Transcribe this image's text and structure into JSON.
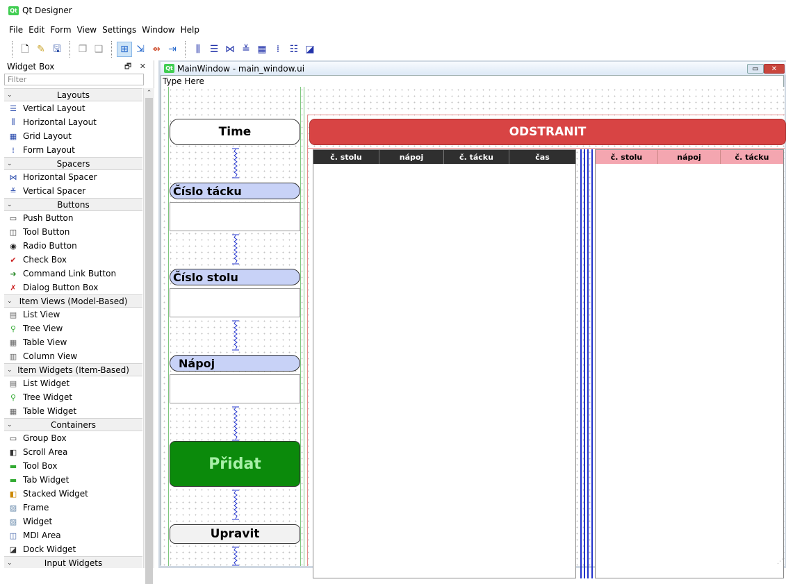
{
  "app": {
    "title": "Qt Designer",
    "logo_text": "Qt"
  },
  "menu": [
    "File",
    "Edit",
    "Form",
    "View",
    "Settings",
    "Window",
    "Help"
  ],
  "toolbar": {
    "groups": [
      [
        "new-file-icon",
        "open-file-icon",
        "save-file-icon"
      ],
      [
        "send-to-back-icon",
        "bring-to-front-icon"
      ],
      [
        "edit-widgets-icon",
        "edit-signals-slots-icon",
        "edit-buddies-icon",
        "edit-tab-order-icon"
      ],
      [
        "layout-horizontal-icon",
        "layout-vertical-icon",
        "layout-horizontal-splitter-icon",
        "layout-vertical-splitter-icon",
        "layout-grid-icon",
        "layout-form-icon",
        "break-layout-icon",
        "adjust-size-icon"
      ]
    ]
  },
  "widget_box": {
    "title": "Widget Box",
    "controls": "🗗 ✕",
    "filter_placeholder": "Filter",
    "categories": [
      {
        "label": "Layouts",
        "items": [
          {
            "label": "Vertical Layout",
            "icon": "vertical-layout-icon"
          },
          {
            "label": "Horizontal Layout",
            "icon": "horizontal-layout-icon"
          },
          {
            "label": "Grid Layout",
            "icon": "grid-layout-icon"
          },
          {
            "label": "Form Layout",
            "icon": "form-layout-icon"
          }
        ]
      },
      {
        "label": "Spacers",
        "items": [
          {
            "label": "Horizontal Spacer",
            "icon": "horizontal-spacer-icon"
          },
          {
            "label": "Vertical Spacer",
            "icon": "vertical-spacer-icon"
          }
        ]
      },
      {
        "label": "Buttons",
        "items": [
          {
            "label": "Push Button",
            "icon": "push-button-icon"
          },
          {
            "label": "Tool Button",
            "icon": "tool-button-icon"
          },
          {
            "label": "Radio Button",
            "icon": "radio-button-icon"
          },
          {
            "label": "Check Box",
            "icon": "check-box-icon"
          },
          {
            "label": "Command Link Button",
            "icon": "command-link-icon"
          },
          {
            "label": "Dialog Button Box",
            "icon": "dialog-button-box-icon"
          }
        ]
      },
      {
        "label": "Item Views (Model-Based)",
        "items": [
          {
            "label": "List View",
            "icon": "list-view-icon"
          },
          {
            "label": "Tree View",
            "icon": "tree-view-icon"
          },
          {
            "label": "Table View",
            "icon": "table-view-icon"
          },
          {
            "label": "Column View",
            "icon": "column-view-icon"
          }
        ]
      },
      {
        "label": "Item Widgets (Item-Based)",
        "items": [
          {
            "label": "List Widget",
            "icon": "list-widget-icon"
          },
          {
            "label": "Tree Widget",
            "icon": "tree-widget-icon"
          },
          {
            "label": "Table Widget",
            "icon": "table-widget-icon"
          }
        ]
      },
      {
        "label": "Containers",
        "items": [
          {
            "label": "Group Box",
            "icon": "group-box-icon"
          },
          {
            "label": "Scroll Area",
            "icon": "scroll-area-icon"
          },
          {
            "label": "Tool Box",
            "icon": "tool-box-icon"
          },
          {
            "label": "Tab Widget",
            "icon": "tab-widget-icon"
          },
          {
            "label": "Stacked Widget",
            "icon": "stacked-widget-icon"
          },
          {
            "label": "Frame",
            "icon": "frame-icon"
          },
          {
            "label": "Widget",
            "icon": "widget-icon"
          },
          {
            "label": "MDI Area",
            "icon": "mdi-area-icon"
          },
          {
            "label": "Dock Widget",
            "icon": "dock-widget-icon"
          }
        ]
      },
      {
        "label": "Input Widgets",
        "items": []
      }
    ]
  },
  "form_window": {
    "title": "MainWindow - main_window.ui",
    "menu_placeholder": "Type Here",
    "time_label": "Time",
    "tray_label": "Číslo tácku",
    "table_label": "Číslo stolu",
    "drink_label": "Nápoj",
    "add_button": "Přidat",
    "edit_button": "Upravit",
    "remove_button": "ODSTRANIT",
    "table_left": {
      "headers": [
        "č. stolu",
        "nápoj",
        "č. tácku",
        "čas"
      ]
    },
    "table_right": {
      "headers": [
        "č. stolu",
        "nápoj",
        "č. tácku"
      ]
    }
  },
  "colors": {
    "remove": "#d84444",
    "add": "#0b8a0b",
    "add_text": "#a8f0a8",
    "label_bg": "#c8d2f7",
    "left_header": "#2f2f2f",
    "right_header": "#f4a6b0"
  }
}
